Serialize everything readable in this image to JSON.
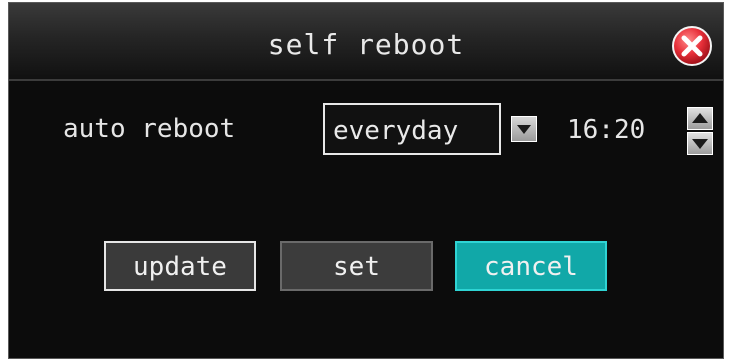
{
  "dialog": {
    "title": "self reboot",
    "close_icon": "close-icon"
  },
  "auto_reboot": {
    "label": "auto reboot",
    "frequency_selected": "everyday",
    "dropdown_icon": "chevron-down-icon",
    "time": "16:20",
    "spinner_up_icon": "arrow-up-icon",
    "spinner_down_icon": "arrow-down-icon"
  },
  "buttons": {
    "update": "update",
    "set": "set",
    "cancel": "cancel"
  },
  "colors": {
    "background": "#0c0c0c",
    "accent": "#11a8a8",
    "close_red": "#e8303a",
    "text": "#e9e9e9"
  }
}
